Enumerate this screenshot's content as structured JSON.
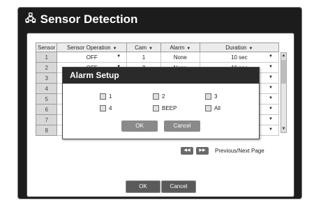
{
  "window": {
    "title": "Sensor Detection",
    "title_icon": "sensor-icon"
  },
  "table": {
    "headers": [
      "Sensor",
      "Sensor Operation",
      "Cam",
      "Alarm",
      "Duration"
    ],
    "rows": [
      {
        "sensor": "1",
        "operation": "OFF",
        "cam": "1",
        "alarm": "None",
        "duration": "10 sec"
      },
      {
        "sensor": "2",
        "operation": "OFF",
        "cam": "2",
        "alarm": "None",
        "duration": "10 sec"
      },
      {
        "sensor": "3",
        "operation": "",
        "cam": "",
        "alarm": "",
        "duration": ""
      },
      {
        "sensor": "4",
        "operation": "",
        "cam": "",
        "alarm": "",
        "duration": ""
      },
      {
        "sensor": "5",
        "operation": "",
        "cam": "",
        "alarm": "",
        "duration": ""
      },
      {
        "sensor": "6",
        "operation": "",
        "cam": "",
        "alarm": "",
        "duration": ""
      },
      {
        "sensor": "7",
        "operation": "",
        "cam": "",
        "alarm": "",
        "duration": ""
      },
      {
        "sensor": "8",
        "operation": "",
        "cam": "",
        "alarm": "",
        "duration": ""
      }
    ]
  },
  "pager": {
    "label": "Previous/Next Page"
  },
  "buttons": {
    "ok": "OK",
    "cancel": "Cancel"
  },
  "modal": {
    "title": "Alarm Setup",
    "options": [
      "1",
      "2",
      "3",
      "4",
      "BEEP",
      "All"
    ],
    "ok": "OK",
    "cancel": "Cancel"
  }
}
